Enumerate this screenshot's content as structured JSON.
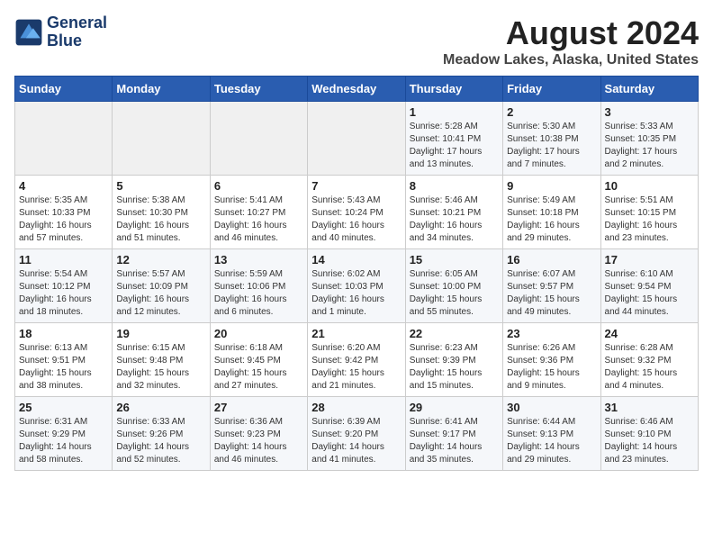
{
  "logo": {
    "line1": "General",
    "line2": "Blue"
  },
  "title": "August 2024",
  "subtitle": "Meadow Lakes, Alaska, United States",
  "days_of_week": [
    "Sunday",
    "Monday",
    "Tuesday",
    "Wednesday",
    "Thursday",
    "Friday",
    "Saturday"
  ],
  "weeks": [
    [
      {
        "day": "",
        "info": ""
      },
      {
        "day": "",
        "info": ""
      },
      {
        "day": "",
        "info": ""
      },
      {
        "day": "",
        "info": ""
      },
      {
        "day": "1",
        "info": "Sunrise: 5:28 AM\nSunset: 10:41 PM\nDaylight: 17 hours\nand 13 minutes."
      },
      {
        "day": "2",
        "info": "Sunrise: 5:30 AM\nSunset: 10:38 PM\nDaylight: 17 hours\nand 7 minutes."
      },
      {
        "day": "3",
        "info": "Sunrise: 5:33 AM\nSunset: 10:35 PM\nDaylight: 17 hours\nand 2 minutes."
      }
    ],
    [
      {
        "day": "4",
        "info": "Sunrise: 5:35 AM\nSunset: 10:33 PM\nDaylight: 16 hours\nand 57 minutes."
      },
      {
        "day": "5",
        "info": "Sunrise: 5:38 AM\nSunset: 10:30 PM\nDaylight: 16 hours\nand 51 minutes."
      },
      {
        "day": "6",
        "info": "Sunrise: 5:41 AM\nSunset: 10:27 PM\nDaylight: 16 hours\nand 46 minutes."
      },
      {
        "day": "7",
        "info": "Sunrise: 5:43 AM\nSunset: 10:24 PM\nDaylight: 16 hours\nand 40 minutes."
      },
      {
        "day": "8",
        "info": "Sunrise: 5:46 AM\nSunset: 10:21 PM\nDaylight: 16 hours\nand 34 minutes."
      },
      {
        "day": "9",
        "info": "Sunrise: 5:49 AM\nSunset: 10:18 PM\nDaylight: 16 hours\nand 29 minutes."
      },
      {
        "day": "10",
        "info": "Sunrise: 5:51 AM\nSunset: 10:15 PM\nDaylight: 16 hours\nand 23 minutes."
      }
    ],
    [
      {
        "day": "11",
        "info": "Sunrise: 5:54 AM\nSunset: 10:12 PM\nDaylight: 16 hours\nand 18 minutes."
      },
      {
        "day": "12",
        "info": "Sunrise: 5:57 AM\nSunset: 10:09 PM\nDaylight: 16 hours\nand 12 minutes."
      },
      {
        "day": "13",
        "info": "Sunrise: 5:59 AM\nSunset: 10:06 PM\nDaylight: 16 hours\nand 6 minutes."
      },
      {
        "day": "14",
        "info": "Sunrise: 6:02 AM\nSunset: 10:03 PM\nDaylight: 16 hours\nand 1 minute."
      },
      {
        "day": "15",
        "info": "Sunrise: 6:05 AM\nSunset: 10:00 PM\nDaylight: 15 hours\nand 55 minutes."
      },
      {
        "day": "16",
        "info": "Sunrise: 6:07 AM\nSunset: 9:57 PM\nDaylight: 15 hours\nand 49 minutes."
      },
      {
        "day": "17",
        "info": "Sunrise: 6:10 AM\nSunset: 9:54 PM\nDaylight: 15 hours\nand 44 minutes."
      }
    ],
    [
      {
        "day": "18",
        "info": "Sunrise: 6:13 AM\nSunset: 9:51 PM\nDaylight: 15 hours\nand 38 minutes."
      },
      {
        "day": "19",
        "info": "Sunrise: 6:15 AM\nSunset: 9:48 PM\nDaylight: 15 hours\nand 32 minutes."
      },
      {
        "day": "20",
        "info": "Sunrise: 6:18 AM\nSunset: 9:45 PM\nDaylight: 15 hours\nand 27 minutes."
      },
      {
        "day": "21",
        "info": "Sunrise: 6:20 AM\nSunset: 9:42 PM\nDaylight: 15 hours\nand 21 minutes."
      },
      {
        "day": "22",
        "info": "Sunrise: 6:23 AM\nSunset: 9:39 PM\nDaylight: 15 hours\nand 15 minutes."
      },
      {
        "day": "23",
        "info": "Sunrise: 6:26 AM\nSunset: 9:36 PM\nDaylight: 15 hours\nand 9 minutes."
      },
      {
        "day": "24",
        "info": "Sunrise: 6:28 AM\nSunset: 9:32 PM\nDaylight: 15 hours\nand 4 minutes."
      }
    ],
    [
      {
        "day": "25",
        "info": "Sunrise: 6:31 AM\nSunset: 9:29 PM\nDaylight: 14 hours\nand 58 minutes."
      },
      {
        "day": "26",
        "info": "Sunrise: 6:33 AM\nSunset: 9:26 PM\nDaylight: 14 hours\nand 52 minutes."
      },
      {
        "day": "27",
        "info": "Sunrise: 6:36 AM\nSunset: 9:23 PM\nDaylight: 14 hours\nand 46 minutes."
      },
      {
        "day": "28",
        "info": "Sunrise: 6:39 AM\nSunset: 9:20 PM\nDaylight: 14 hours\nand 41 minutes."
      },
      {
        "day": "29",
        "info": "Sunrise: 6:41 AM\nSunset: 9:17 PM\nDaylight: 14 hours\nand 35 minutes."
      },
      {
        "day": "30",
        "info": "Sunrise: 6:44 AM\nSunset: 9:13 PM\nDaylight: 14 hours\nand 29 minutes."
      },
      {
        "day": "31",
        "info": "Sunrise: 6:46 AM\nSunset: 9:10 PM\nDaylight: 14 hours\nand 23 minutes."
      }
    ]
  ]
}
